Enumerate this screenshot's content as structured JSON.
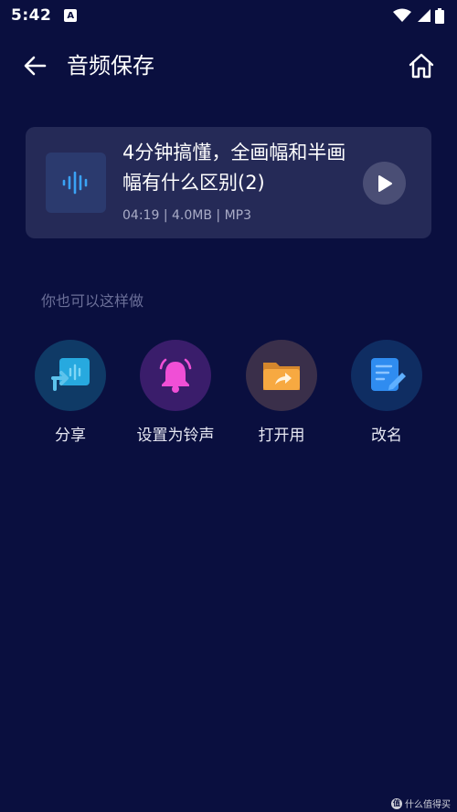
{
  "status_bar": {
    "time": "5:42",
    "notification_glyph": "A",
    "icons": [
      "wifi-icon",
      "signal-icon",
      "battery-icon"
    ]
  },
  "app_bar": {
    "title": "音频保存",
    "back_icon": "arrow-left-icon",
    "home_icon": "home-icon"
  },
  "audio_card": {
    "title": "4分钟搞懂，全画幅和半画幅有什么区别(2)",
    "duration": "04:19",
    "size": "4.0MB",
    "format": "MP3",
    "separator": "|",
    "thumb_icon": "audio-wave-icon",
    "play_icon": "play-icon"
  },
  "hint": "你也可以这样做",
  "actions": [
    {
      "label": "分享",
      "icon": "share-icon",
      "color": "#2aa6e0"
    },
    {
      "label": "设置为铃声",
      "icon": "bell-icon",
      "color": "#f050d8"
    },
    {
      "label": "打开用",
      "icon": "folder-open-icon",
      "color": "#f5a640"
    },
    {
      "label": "改名",
      "icon": "edit-note-icon",
      "color": "#2f8cf0"
    }
  ],
  "watermark": {
    "badge": "值",
    "text": "什么值得买"
  },
  "colors": {
    "background": "#0a0f3f",
    "card": "#252a57",
    "hint": "#6b6f98"
  }
}
